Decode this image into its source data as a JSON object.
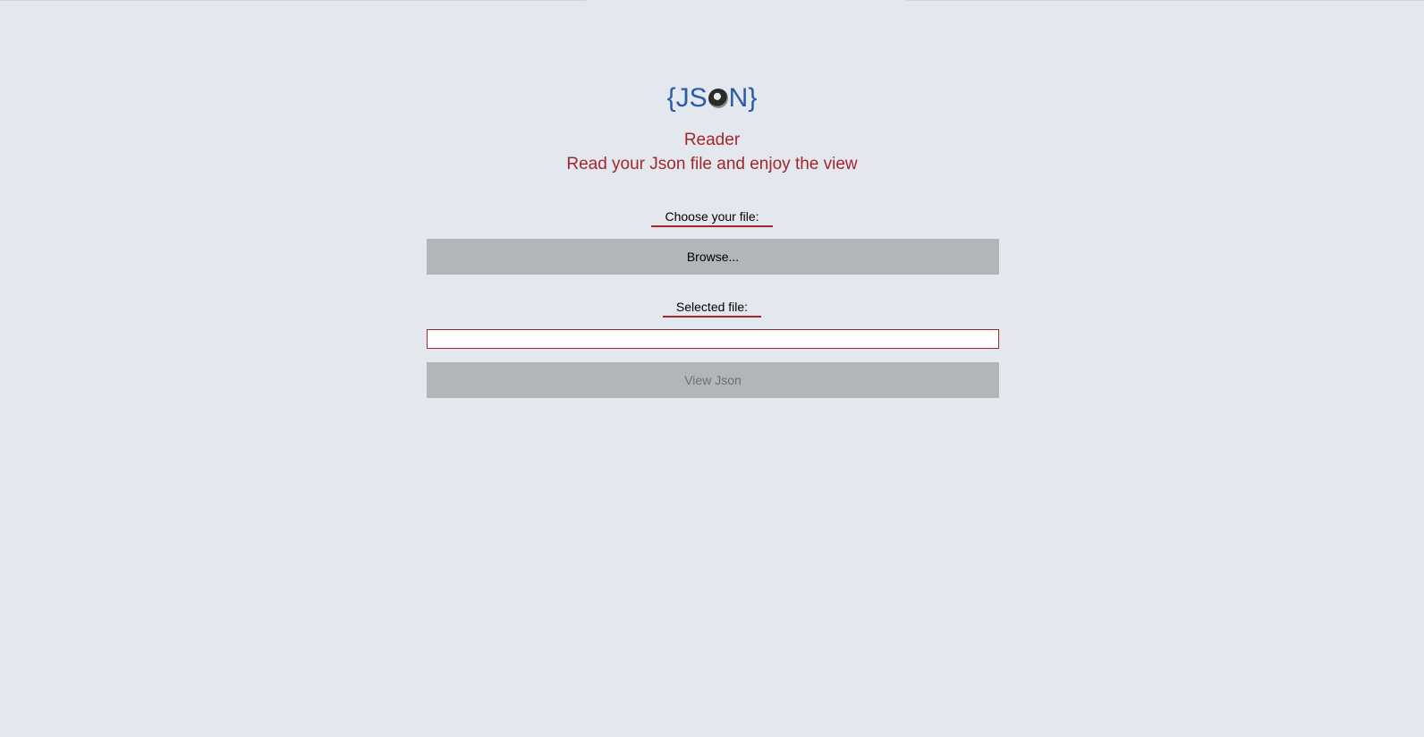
{
  "app": {
    "logo_text_left": "{JS",
    "logo_text_right": "N}",
    "title": "Reader",
    "subtitle": "Read your Json file and enjoy the view"
  },
  "form": {
    "choose_label": "Choose your file:",
    "browse_label": "Browse...",
    "selected_label": "Selected file:",
    "selected_value": "",
    "view_label": "View Json"
  },
  "colors": {
    "background": "#e3e8ee",
    "accent": "#a4262c",
    "logo": "#2a5ba8",
    "button": "#b3b6b9"
  }
}
